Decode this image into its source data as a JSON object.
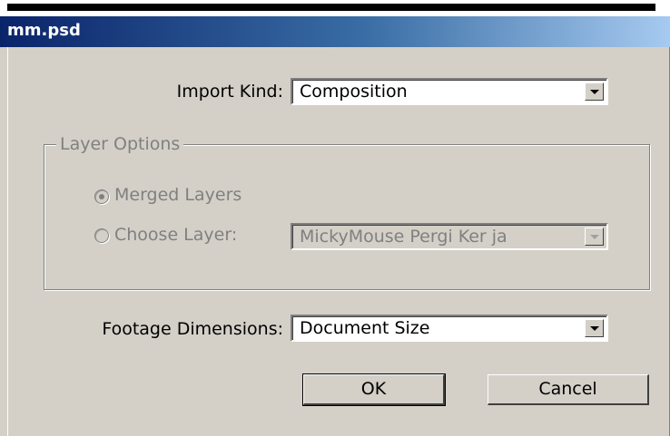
{
  "window": {
    "title": "mm.psd"
  },
  "import_kind": {
    "label": "Import Kind:",
    "value": "Composition"
  },
  "layer_options": {
    "title": "Layer Options",
    "merged_label": "Merged Layers",
    "choose_label": "Choose Layer:",
    "choose_value": "MickyMouse Pergi Ker ja",
    "selected": "merged"
  },
  "footage": {
    "label": "Footage Dimensions:",
    "value": "Document Size"
  },
  "buttons": {
    "ok": "OK",
    "cancel": "Cancel"
  }
}
